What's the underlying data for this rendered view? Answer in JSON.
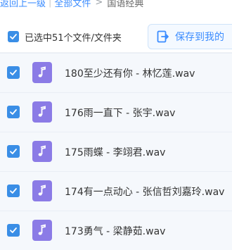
{
  "breadcrumb": {
    "back": "返回上一级",
    "all_files": "全部文件",
    "current": "国语经典",
    "separator_bar": "|",
    "separator_arrow": ">"
  },
  "toolbar": {
    "selection_text": "已选中51个文件/文件夹",
    "select_all_checked": true,
    "save_label": "保存到我的"
  },
  "files": [
    {
      "name": "180至少还有你 - 林忆莲.wav",
      "checked": true,
      "icon": "music-file-icon"
    },
    {
      "name": "176雨一直下 - 张宇.wav",
      "checked": true,
      "icon": "music-file-icon"
    },
    {
      "name": "175雨蝶 - 李翊君.wav",
      "checked": true,
      "icon": "music-file-icon"
    },
    {
      "name": "174有一点动心 - 张信哲刘嘉玲.wav",
      "checked": true,
      "icon": "music-file-icon"
    },
    {
      "name": "173勇气 - 梁静茹.wav",
      "checked": true,
      "icon": "music-file-icon"
    }
  ],
  "colors": {
    "accent": "#3b8cff",
    "checkbox": "#3a8ee6",
    "music_icon": "#8b7be6",
    "row_bg": "#f5f8fc"
  }
}
